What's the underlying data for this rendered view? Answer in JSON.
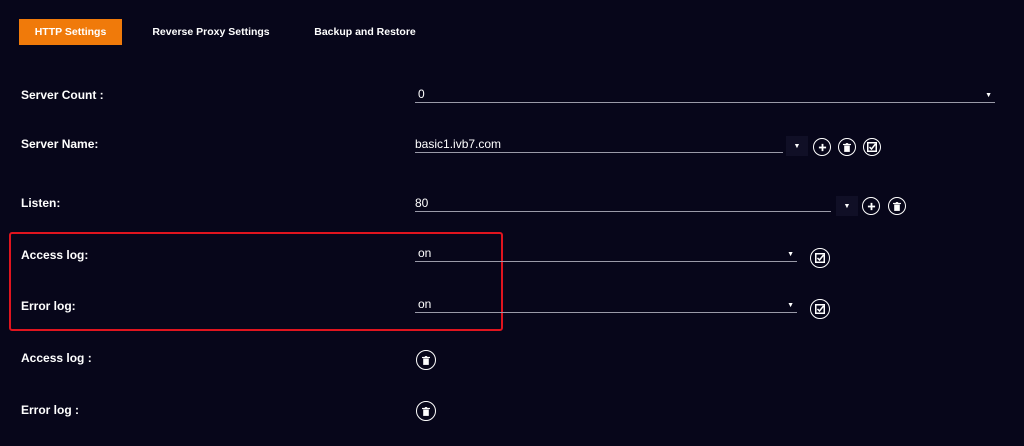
{
  "tabs": {
    "http_settings": "HTTP Settings",
    "reverse_proxy_settings": "Reverse Proxy Settings",
    "backup_and_restore": "Backup and Restore"
  },
  "colors": {
    "accent": "#f07a0a",
    "background": "#07061a",
    "highlight": "#e0141e"
  },
  "form": {
    "server_count": {
      "label": "Server Count :",
      "value": "0",
      "icon": "caret-down-icon"
    },
    "server_name": {
      "label": "Server Name:",
      "value": "basic1.ivb7.com",
      "icons": [
        "caret-down-icon",
        "plus-icon",
        "trash-icon",
        "checkbox-icon"
      ]
    },
    "listen": {
      "label": "Listen:",
      "value": "80",
      "icons": [
        "caret-down-icon",
        "plus-icon",
        "trash-icon"
      ]
    },
    "access_log": {
      "label": "Access log:",
      "value": "on",
      "icons": [
        "caret-down-icon",
        "checkbox-icon"
      ]
    },
    "error_log": {
      "label": "Error log:",
      "value": "on",
      "icons": [
        "caret-down-icon",
        "checkbox-icon"
      ]
    },
    "access_log_2": {
      "label": "Access log :",
      "icons": [
        "trash-icon"
      ]
    },
    "error_log_2": {
      "label": "Error log :",
      "icons": [
        "trash-icon"
      ]
    }
  }
}
